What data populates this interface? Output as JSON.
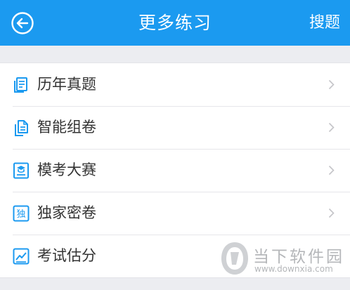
{
  "header": {
    "title": "更多练习",
    "search_label": "搜题",
    "back_icon": "back-arrow-circle-icon",
    "background_color": "#1b9af0"
  },
  "list": {
    "items": [
      {
        "label": "历年真题",
        "icon": "document-stack-icon"
      },
      {
        "label": "智能组卷",
        "icon": "copy-document-icon"
      },
      {
        "label": "模考大赛",
        "icon": "exam-cap-icon"
      },
      {
        "label": "独家密卷",
        "icon": "exclusive-badge-icon",
        "icon_text": "独"
      },
      {
        "label": "考试估分",
        "icon": "score-chart-icon"
      }
    ],
    "icon_color": "#1b9af0",
    "chevron_icon": "chevron-right-icon"
  },
  "watermark": {
    "name": "当下软件园",
    "url": "www.downxia.com"
  }
}
